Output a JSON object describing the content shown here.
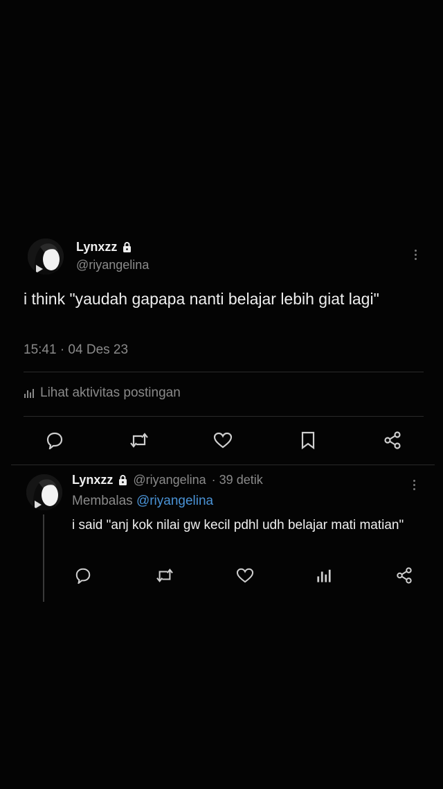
{
  "main_tweet": {
    "display_name": "Lynxzz",
    "handle": "@riyangelina",
    "text": "i think \"yaudah gapapa nanti belajar lebih giat lagi\"",
    "timestamp": "15:41 · 04 Des 23",
    "activity_label": "Lihat aktivitas postingan"
  },
  "reply": {
    "display_name": "Lynxzz",
    "handle": "@riyangelina",
    "time": "· 39 detik",
    "replying_prefix": "Membalas",
    "replying_to": "@riyangelina",
    "text": "i said \"anj kok nilai gw kecil pdhl udh belajar mati matian\""
  },
  "icons": {
    "reply": "reply-icon",
    "retweet": "retweet-icon",
    "like": "heart-icon",
    "bookmark": "bookmark-icon",
    "share": "share-icon",
    "views": "views-icon",
    "lock": "lock-icon",
    "more": "more-icon"
  },
  "colors": {
    "background": "#040404",
    "link": "#4a93d6",
    "muted": "#8a8a8a"
  }
}
